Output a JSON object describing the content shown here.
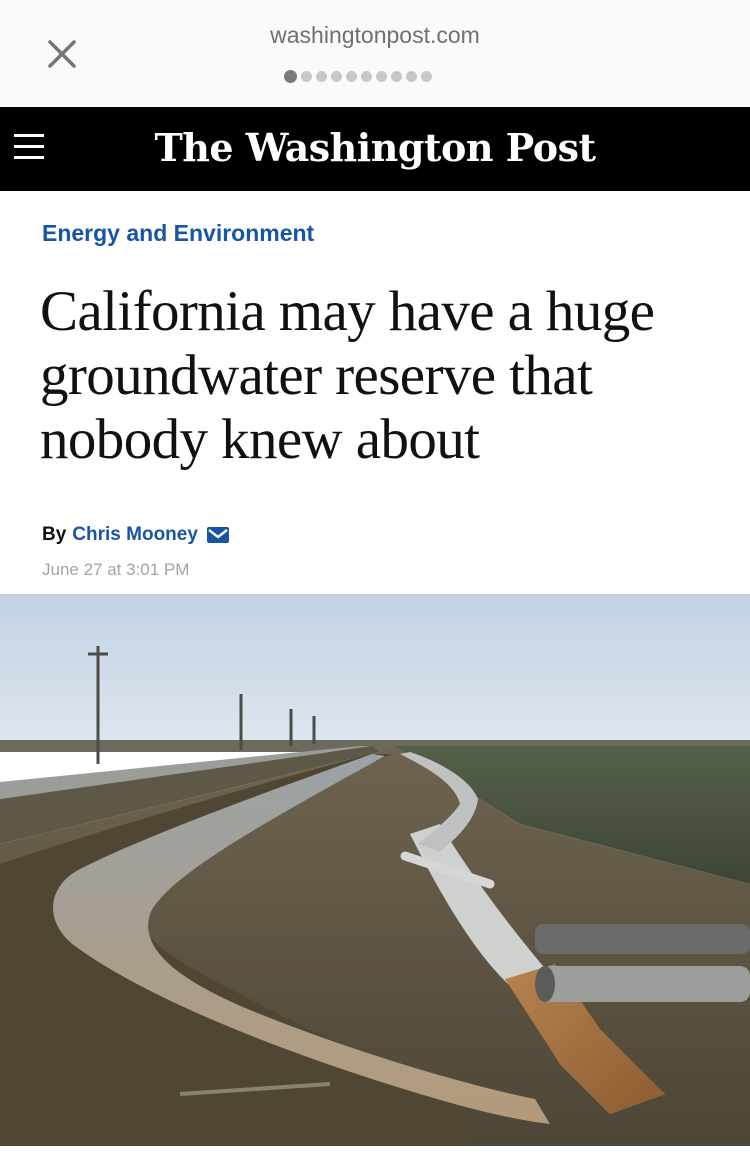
{
  "browser": {
    "url": "washingtonpost.com",
    "close_icon": "close-icon",
    "page_dots": {
      "count": 10,
      "active_index": 0
    }
  },
  "header": {
    "menu_icon": "hamburger-menu-icon",
    "masthead": "The Washington Post",
    "background": "#000000"
  },
  "article": {
    "section": "Energy and Environment",
    "headline": "California may have a huge groundwater reserve that nobody knew about",
    "byline_prefix": "By",
    "author": "Chris Mooney",
    "author_icon": "mail-icon",
    "timestamp": "June 27 at 3:01 PM",
    "accent_color": "#1955a5"
  },
  "lead_image": {
    "alt": "Irrigation ditch and pipes in a flat farm field"
  }
}
